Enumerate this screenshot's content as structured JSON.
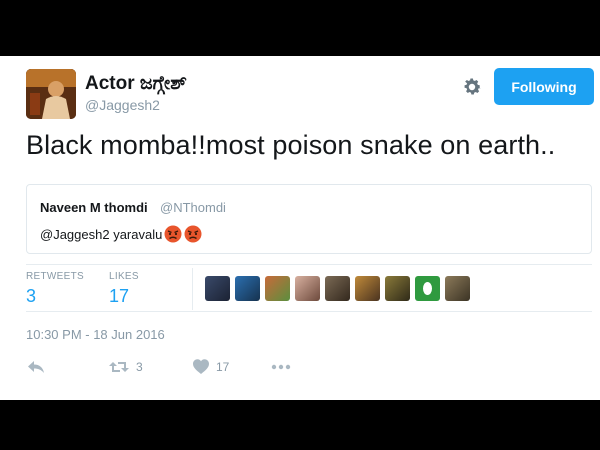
{
  "tweet": {
    "author_name": "Actor ಜಗ್ಗೇಶ್",
    "author_handle": "@Jaggesh2",
    "follow_label": "Following",
    "text": "Black momba!!most poison snake on earth..",
    "quote": {
      "name": "Naveen M thomdi",
      "handle": "@NThomdi",
      "text": "@Jaggesh2 yaravalu"
    },
    "stats": {
      "retweets_label": "RETWEETS",
      "retweets_value": "3",
      "likes_label": "LIKES",
      "likes_value": "17"
    },
    "timestamp": "10:30 PM - 18 Jun 2016",
    "actions": {
      "retweet_count": "3",
      "like_count": "17"
    }
  },
  "colors": {
    "accent": "#1da1f2",
    "muted": "#8899a6",
    "text": "#14171a"
  },
  "icons": [
    "gear-icon",
    "reply-icon",
    "retweet-icon",
    "heart-icon",
    "more-icon",
    "angry-emoji"
  ]
}
